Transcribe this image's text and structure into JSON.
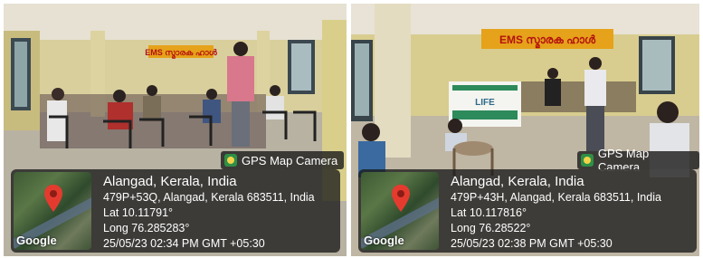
{
  "photos": [
    {
      "app_tag": "GPS Map Camera",
      "map_logo": "Google",
      "icon": "map-pin-icon",
      "location": "Alangad, Kerala, India",
      "address": "479P+53Q, Alangad, Kerala 683511, India",
      "lat": "Lat 10.11791°",
      "long": "Long 76.285283°",
      "datetime": "25/05/23 02:34 PM GMT +05:30",
      "banner": "EMS സ്മാരക ഹാൾ"
    },
    {
      "app_tag": "GPS Map Camera",
      "map_logo": "Google",
      "icon": "map-pin-icon",
      "location": "Alangad, Kerala, India",
      "address": "479P+43H, Alangad, Kerala 683511, India",
      "lat": "Lat 10.117816°",
      "long": "Long 76.28522°",
      "datetime": "25/05/23 02:38 PM GMT +05:30",
      "banner": "EMS സ്മാരക ഹാൾ",
      "poster": "LIFE"
    }
  ]
}
